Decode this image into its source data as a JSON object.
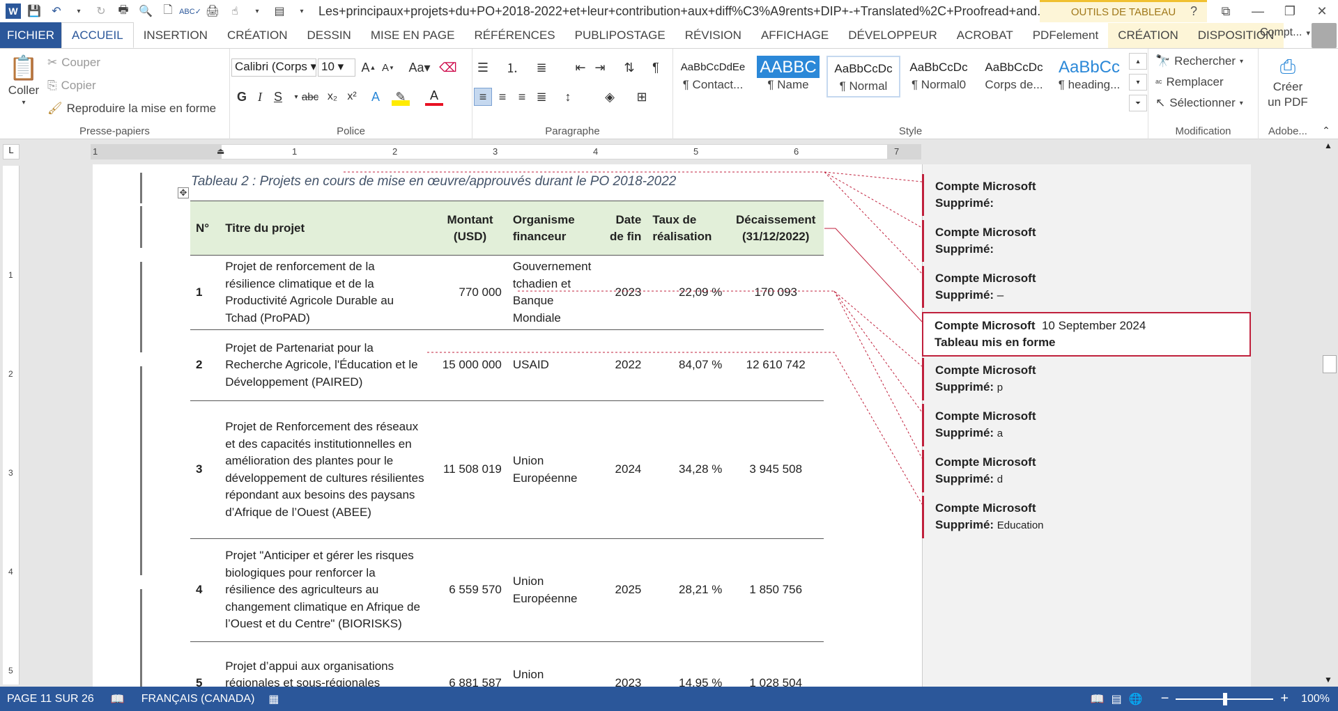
{
  "window": {
    "doc_title": "Les+principaux+projets+du+PO+2018-2022+et+leur+contribution+aux+diff%C3%A9rents+DIP+-+Translated%2C+Proofread+and...",
    "context_tools": "OUTILS DE TABLEAU"
  },
  "tabs": [
    "FICHIER",
    "ACCUEIL",
    "INSERTION",
    "CRÉATION",
    "DESSIN",
    "MISE EN PAGE",
    "RÉFÉRENCES",
    "PUBLIPOSTAGE",
    "RÉVISION",
    "AFFICHAGE",
    "DÉVELOPPEUR",
    "ACROBAT",
    "PDFelement",
    "CRÉATION",
    "DISPOSITION"
  ],
  "account": "Compt...",
  "ribbon": {
    "clipboard": {
      "paste": "Coller",
      "cut": "Couper",
      "copy": "Copier",
      "format_painter": "Reproduire la mise en forme",
      "label": "Presse-papiers"
    },
    "font": {
      "name": "Calibri (Corps",
      "size": "10",
      "bold": "G",
      "italic": "I",
      "underline": "S",
      "strike": "abc",
      "sub": "x₂",
      "sup": "x²",
      "change_case": "Aa",
      "label": "Police"
    },
    "paragraph": {
      "label": "Paragraphe"
    },
    "styles": {
      "label": "Style",
      "items": [
        {
          "preview": "AaBbCcDdEe",
          "name": "¶ Contact..."
        },
        {
          "preview": "AABBC",
          "name": "¶ Name"
        },
        {
          "preview": "AaBbCcDc",
          "name": "¶ Normal"
        },
        {
          "preview": "AaBbCcDc",
          "name": "¶ Normal0"
        },
        {
          "preview": "AaBbCcDc",
          "name": "Corps de..."
        },
        {
          "preview": "AaBbCc",
          "name": "¶ heading..."
        }
      ]
    },
    "editing": {
      "find": "Rechercher",
      "replace": "Remplacer",
      "select": "Sélectionner",
      "label": "Modification"
    },
    "adobe": {
      "create_pdf_1": "Créer",
      "create_pdf_2": "un PDF",
      "label": "Adobe..."
    }
  },
  "ruler": {
    "h_ticks": [
      "1",
      "1",
      "2",
      "3",
      "4",
      "5",
      "6",
      "7"
    ],
    "v_ticks": [
      "1",
      "2",
      "3",
      "4",
      "5"
    ]
  },
  "document": {
    "caption": "Tableau 2 : Projets en cours de mise en œuvre/approuvés durant le PO 2018-2022",
    "headers": [
      "N°",
      "Titre du projet",
      "Montant (USD)",
      "Organisme financeur",
      "Date de fin",
      "Taux de réalisation",
      "Décaissement (31/12/2022)"
    ],
    "rows": [
      {
        "n": "1",
        "title": "Projet de renforcement de la résilience climatique et de la Productivité Agricole Durable au Tchad (ProPAD)",
        "amount": "770 000",
        "funder": "Gouvernement tchadien et Banque Mondiale",
        "end": "2023",
        "rate": "22,09 %",
        "disb": "170 093"
      },
      {
        "n": "2",
        "title": "Projet de Partenariat pour la Recherche Agricole, l'Éducation et le Développement (PAIRED)",
        "amount": "15 000 000",
        "funder": "USAID",
        "end": "2022",
        "rate": "84,07 %",
        "disb": "12 610 742"
      },
      {
        "n": "3",
        "title": "Projet de Renforcement des réseaux et des capacités institutionnelles en amélioration des plantes pour le développement de cultures résilientes répondant aux besoins des paysans d’Afrique de l’Ouest (ABEE)",
        "amount": "11 508 019",
        "funder": "Union Européenne",
        "end": "2024",
        "rate": "34,28 %",
        "disb": "3 945 508"
      },
      {
        "n": "4",
        "title": "Projet \"Anticiper et gérer les risques biologiques pour renforcer la résilience des agriculteurs au changement climatique en Afrique de l’Ouest et du Centre\" (BIORISKS)",
        "amount": "6 559 570",
        "funder": "Union Européenne",
        "end": "2025",
        "rate": "28,21 %",
        "disb": "1 850 756"
      },
      {
        "n": "5",
        "title": "Projet d’appui aux organisations régionales et sous-régionales africaines pour la recherche et",
        "amount": "6 881 587",
        "funder": "Union Européenne",
        "end": "2023",
        "rate": "14,95 %",
        "disb": "1 028 504"
      }
    ]
  },
  "comments": [
    {
      "author": "Compte Microsoft",
      "label": "Supprimé:",
      "text": ""
    },
    {
      "author": "Compte Microsoft",
      "label": "Supprimé:",
      "text": ""
    },
    {
      "author": "Compte Microsoft",
      "label": "Supprimé:",
      "text": "–"
    },
    {
      "author": "Compte Microsoft",
      "date": "10 September 2024",
      "label": "Tableau mis en forme",
      "text": ""
    },
    {
      "author": "Compte Microsoft",
      "label": "Supprimé:",
      "text": "p"
    },
    {
      "author": "Compte Microsoft",
      "label": "Supprimé:",
      "text": "a"
    },
    {
      "author": "Compte Microsoft",
      "label": "Supprimé:",
      "text": "d"
    },
    {
      "author": "Compte Microsoft",
      "label": "Supprimé:",
      "text": "Education"
    }
  ],
  "status": {
    "page": "PAGE 11 SUR 26",
    "language": "FRANÇAIS (CANADA)",
    "zoom": "100%"
  },
  "colors": {
    "accent": "#2b579a",
    "track_change": "#c0203c",
    "header_fill": "#e2efd9"
  }
}
